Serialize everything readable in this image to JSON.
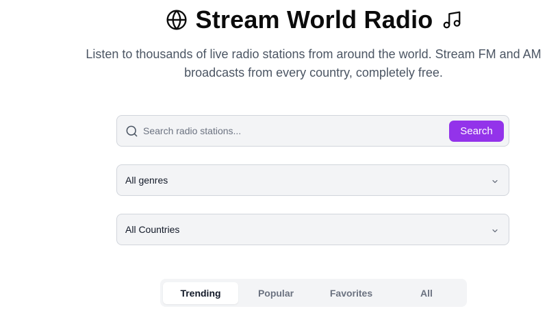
{
  "header": {
    "title": "Stream World Radio",
    "globe_icon": "globe-icon",
    "music_icon": "music-note-icon",
    "subtitle": "Listen to thousands of live radio stations from around the world. Stream FM and AM broadcasts from every country, completely free."
  },
  "search": {
    "placeholder": "Search radio stations...",
    "value": "",
    "button_label": "Search",
    "icon": "search-icon"
  },
  "filters": {
    "genre": {
      "selected": "All genres",
      "icon": "chevron-down-icon"
    },
    "country": {
      "selected": "All Countries",
      "icon": "chevron-down-icon"
    }
  },
  "tabs": [
    {
      "label": "Trending",
      "active": true
    },
    {
      "label": "Popular",
      "active": false
    },
    {
      "label": "Favorites",
      "active": false
    },
    {
      "label": "All",
      "active": false
    }
  ],
  "colors": {
    "accent": "#9333ea",
    "field_background": "#f3f4f6",
    "border": "#d1d5db"
  }
}
